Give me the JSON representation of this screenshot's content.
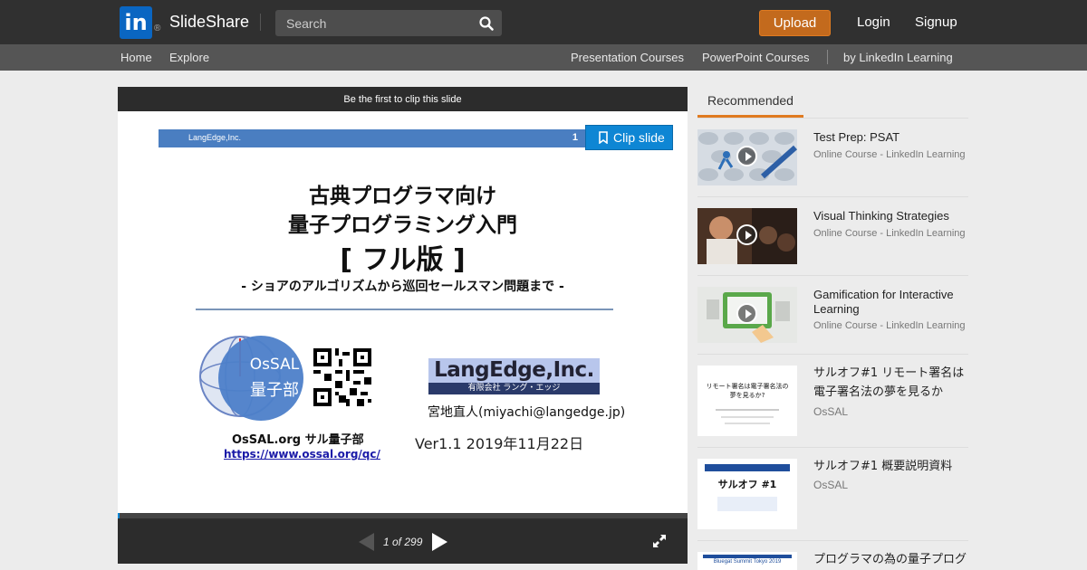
{
  "header": {
    "logo_text": "in",
    "reg_mark": "®",
    "brand": "SlideShare",
    "search_placeholder": "Search",
    "upload": "Upload",
    "login": "Login",
    "signup": "Signup"
  },
  "subnav": {
    "home": "Home",
    "explore": "Explore",
    "presentation_courses": "Presentation Courses",
    "powerpoint_courses": "PowerPoint Courses",
    "by_linkedin": "by LinkedIn Learning"
  },
  "player": {
    "clip_banner": "Be the first to clip this slide",
    "clip_button": "Clip slide",
    "page_indicator": "1 of 299",
    "progress_fraction": 0.0033
  },
  "slide": {
    "header_left": "LangEdge,Inc.",
    "header_num": "1",
    "title_line1": "古典プログラマ向け",
    "title_line2": "量子プログラミング入門",
    "title_line3": "[ フル版 ]",
    "subtitle": "- ショアのアルゴリズムから巡回セールスマン問題まで -",
    "ossal_logo_line1": "OsSAL",
    "ossal_logo_line2": "量子部",
    "org": "OsSAL.org サル量子部",
    "url": "https://www.ossal.org/qc/",
    "company_name": "LangEdge,Inc.",
    "company_sub": "有限会社 ラング・エッジ",
    "author": "宮地直人(miyachi@langedge.jp)",
    "version": "Ver1.1  2019年11月22日"
  },
  "sidebar": {
    "tab": "Recommended",
    "items": [
      {
        "title": "Test Prep: PSAT",
        "subtitle": "Online Course - LinkedIn Learning"
      },
      {
        "title": "Visual Thinking Strategies",
        "subtitle": "Online Course - LinkedIn Learning"
      },
      {
        "title": "Gamification for Interactive Learning",
        "subtitle": "Online Course - LinkedIn Learning"
      },
      {
        "title": "サルオフ#1 リモート署名は電子署名法の夢を見るか",
        "subtitle": "OsSAL",
        "thumb_heading": "リモート署名は電子署名法の夢を見るか?"
      },
      {
        "title": "サルオフ#1 概要説明資料",
        "subtitle": "OsSAL",
        "thumb_heading": "サルオフ #1"
      },
      {
        "title": "プログラマの為の量子プログ",
        "subtitle": "",
        "thumb_heading": "Bluegat Summit Tokyo 2019"
      }
    ]
  },
  "colors": {
    "topbar": "#303030",
    "subnav": "#555555",
    "upload": "#c36a1d",
    "accent": "#e07b21",
    "clip_button": "#0e86d4"
  }
}
